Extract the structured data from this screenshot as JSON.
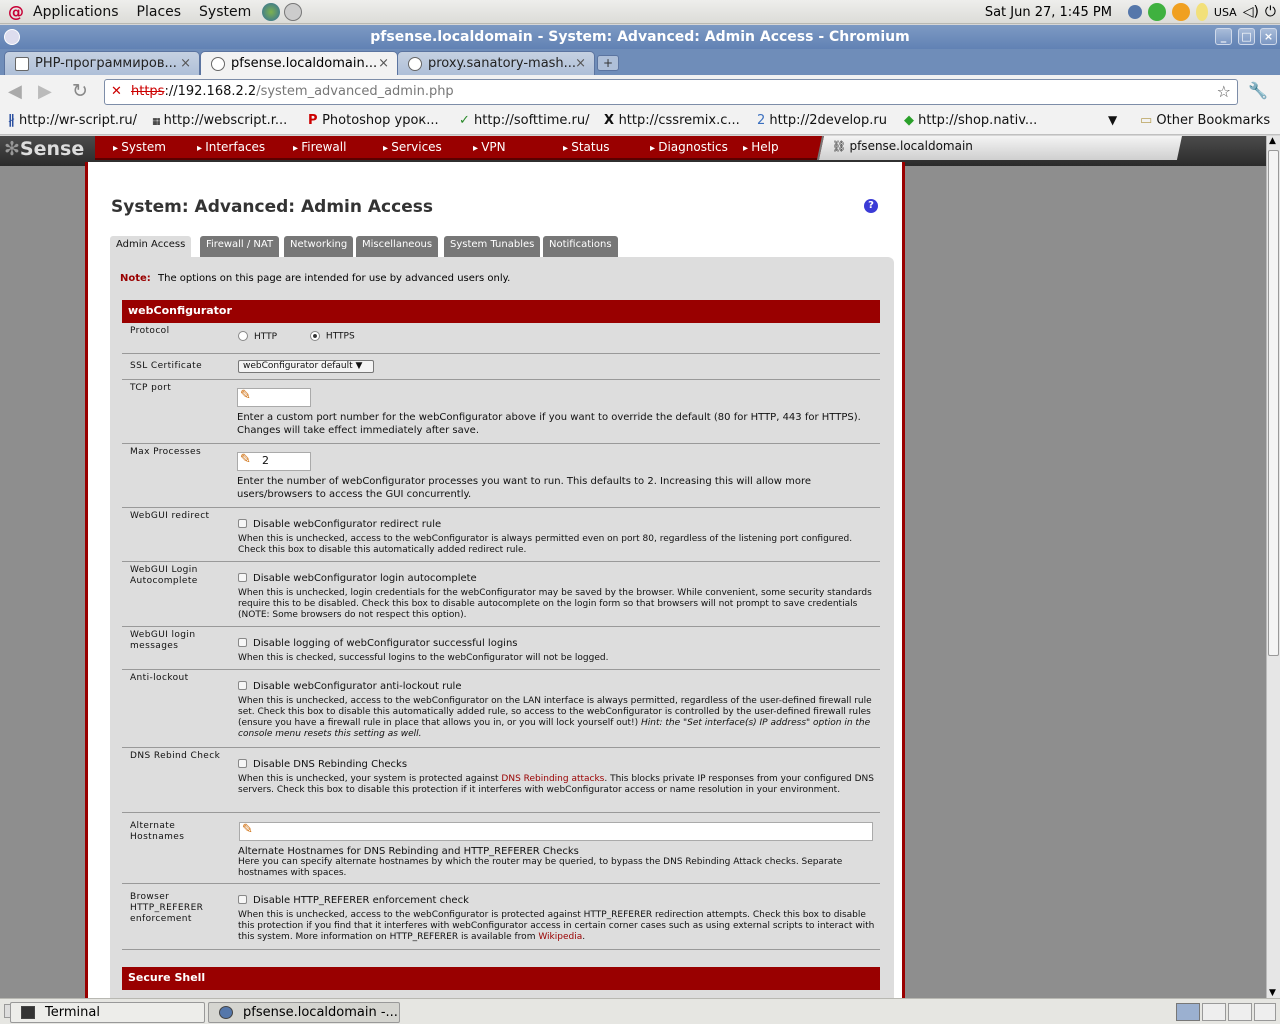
{
  "desktop": {
    "menus": [
      "Applications",
      "Places",
      "System"
    ],
    "clock": "Sat Jun 27,  1:45 PM",
    "keyboard_layout": "USA",
    "taskbar": [
      {
        "label": "Terminal"
      },
      {
        "label": "pfsense.localdomain -..."
      }
    ]
  },
  "browser": {
    "window_title": "pfsense.localdomain - System: Advanced: Admin Access - Chromium",
    "tabs": [
      {
        "label": "PHP-программиров..."
      },
      {
        "label": "pfsense.localdomain..."
      },
      {
        "label": "proxy.sanatory-mash..."
      }
    ],
    "url_scheme": "https",
    "url_host": "://192.168.2.2",
    "url_path": "/system_advanced_admin.php",
    "bookmarks": [
      "http://wr-script.ru/",
      "http://webscript.r...",
      "Photoshop урок...",
      "http://softtime.ru/",
      "http://cssremix.c...",
      "http://2develop.ru",
      "http://shop.nativ..."
    ],
    "other_bookmarks": "Other Bookmarks"
  },
  "pfsense": {
    "logo": "Sense",
    "nav": [
      "System",
      "Interfaces",
      "Firewall",
      "Services",
      "VPN",
      "Status",
      "Diagnostics",
      "Help"
    ],
    "hostname": "pfsense.localdomain",
    "page_title": "System: Advanced: Admin Access",
    "help_icon": "?",
    "tabs": [
      "Admin Access",
      "Firewall / NAT",
      "Networking",
      "Miscellaneous",
      "System Tunables",
      "Notifications"
    ],
    "note_label": "Note:",
    "note_text": "The options on this page are intended for use by advanced users only.",
    "section_webconfigurator": "webConfigurator",
    "section_ssh": "Secure Shell",
    "protocol": {
      "label": "Protocol",
      "http": "HTTP",
      "https": "HTTPS",
      "selected": "HTTPS"
    },
    "ssl": {
      "label": "SSL Certificate",
      "value": "webConfigurator default"
    },
    "tcp_port": {
      "label": "TCP port",
      "value": "",
      "desc1": "Enter a custom port number for the webConfigurator above if you want to override the default (80 for HTTP, 443 for HTTPS).",
      "desc2": "Changes will take effect immediately after save."
    },
    "max_processes": {
      "label": "Max Processes",
      "value": "2",
      "desc": "Enter the number of webConfigurator processes you want to run. This defaults to 2. Increasing this will allow more users/browsers to access the GUI concurrently."
    },
    "redirect": {
      "label": "WebGUI redirect",
      "check": "Disable webConfigurator redirect rule",
      "desc": "When this is unchecked, access to the webConfigurator is always permitted even on port 80, regardless of the listening port configured. Check this box to disable this automatically added redirect rule."
    },
    "autocomplete": {
      "label": "WebGUI Login Autocomplete",
      "check": "Disable webConfigurator login autocomplete",
      "desc": "When this is unchecked, login credentials for the webConfigurator may be saved by the browser. While convenient, some security standards require this to be disabled. Check this box to disable autocomplete on the login form so that browsers will not prompt to save credentials (NOTE: Some browsers do not respect this option)."
    },
    "loginmsg": {
      "label": "WebGUI login messages",
      "check": "Disable logging of webConfigurator successful logins",
      "desc": "When this is checked, successful logins to the webConfigurator will not be logged."
    },
    "antilockout": {
      "label": "Anti-lockout",
      "check": "Disable webConfigurator anti-lockout rule",
      "desc": "When this is unchecked, access to the webConfigurator on the LAN interface is always permitted, regardless of the user-defined firewall rule set. Check this box to disable this automatically added rule, so access to the webConfigurator is controlled by the user-defined firewall rules (ensure you have a firewall rule in place that allows you in, or you will lock yourself out!)",
      "hint": "Hint: the \"Set interface(s) IP address\" option in the console menu resets this setting as well."
    },
    "dnsrebind": {
      "label": "DNS Rebind Check",
      "check": "Disable DNS Rebinding Checks",
      "desc_a": "When this is unchecked, your system is protected against ",
      "link": "DNS Rebinding attacks",
      "desc_b": ". This blocks private IP responses from your configured DNS servers. Check this box to disable this protection if it interferes with webConfigurator access or name resolution in your environment."
    },
    "althosts": {
      "label": "Alternate Hostnames",
      "value": "",
      "title": "Alternate Hostnames for DNS Rebinding and HTTP_REFERER Checks",
      "desc": "Here you can specify alternate hostnames by which the router may be queried, to bypass the DNS Rebinding Attack checks. Separate hostnames with spaces."
    },
    "referer": {
      "label": "Browser HTTP_REFERER enforcement",
      "check": "Disable HTTP_REFERER enforcement check",
      "desc": "When this is unchecked, access to the webConfigurator is protected against HTTP_REFERER redirection attempts. Check this box to disable this protection if you find that it interferes with webConfigurator access in certain corner cases such as using external scripts to interact with this system. More information on HTTP_REFERER is available from ",
      "link": "Wikipedia",
      "end": "."
    }
  }
}
